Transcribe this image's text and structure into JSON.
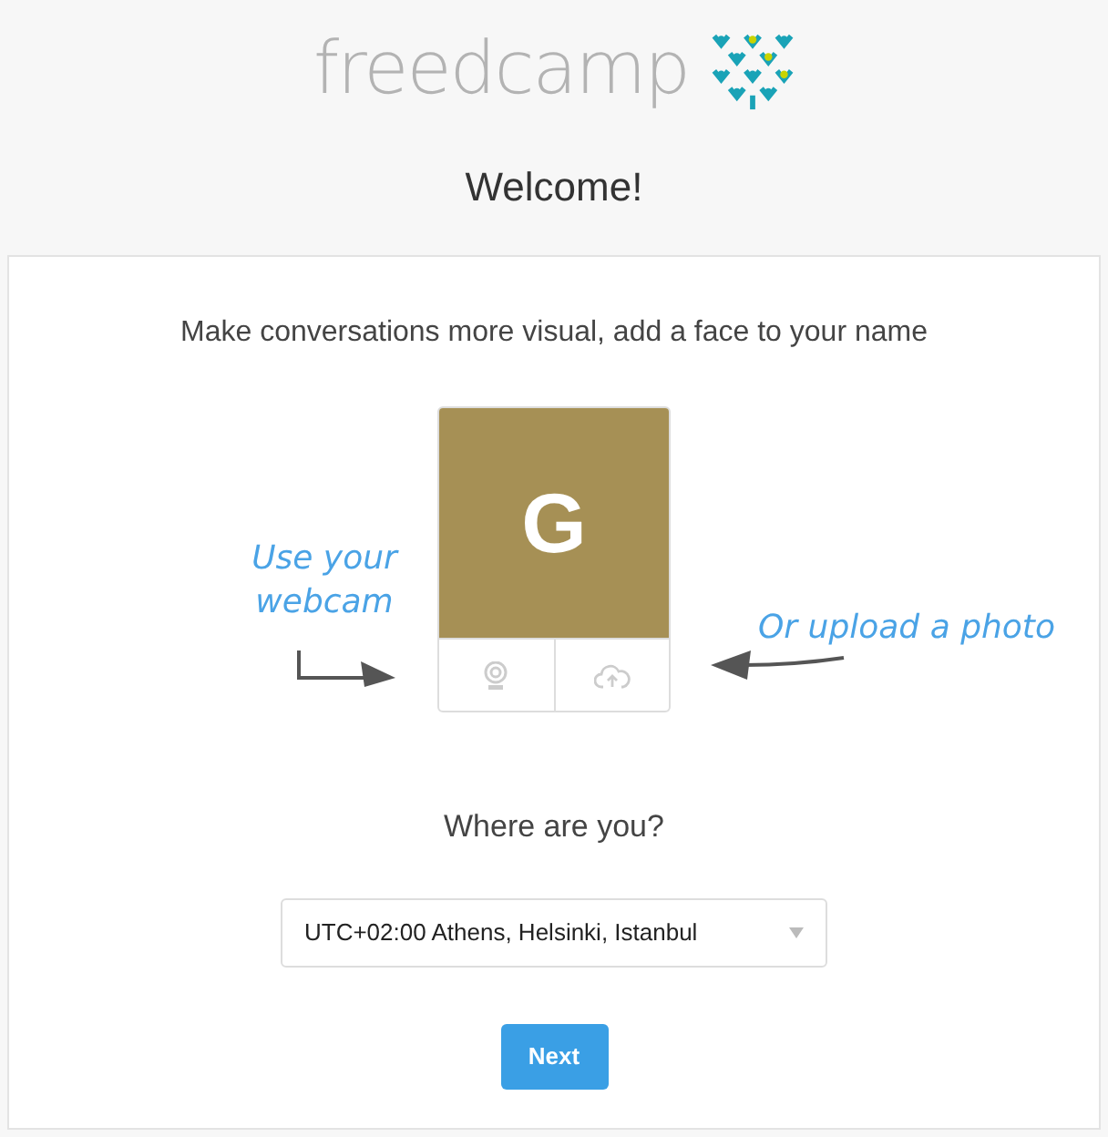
{
  "logo": {
    "text": "freedcamp"
  },
  "heading": "Welcome!",
  "card": {
    "tagline": "Make conversations more visual, add a face to your name",
    "avatar": {
      "initial": "G"
    },
    "webcam_hint": "Use your webcam",
    "upload_hint": "Or upload a photo",
    "location_question": "Where are you?",
    "timezone_select": {
      "value": "UTC+02:00 Athens, Helsinki, Istanbul"
    },
    "next_button": "Next"
  }
}
